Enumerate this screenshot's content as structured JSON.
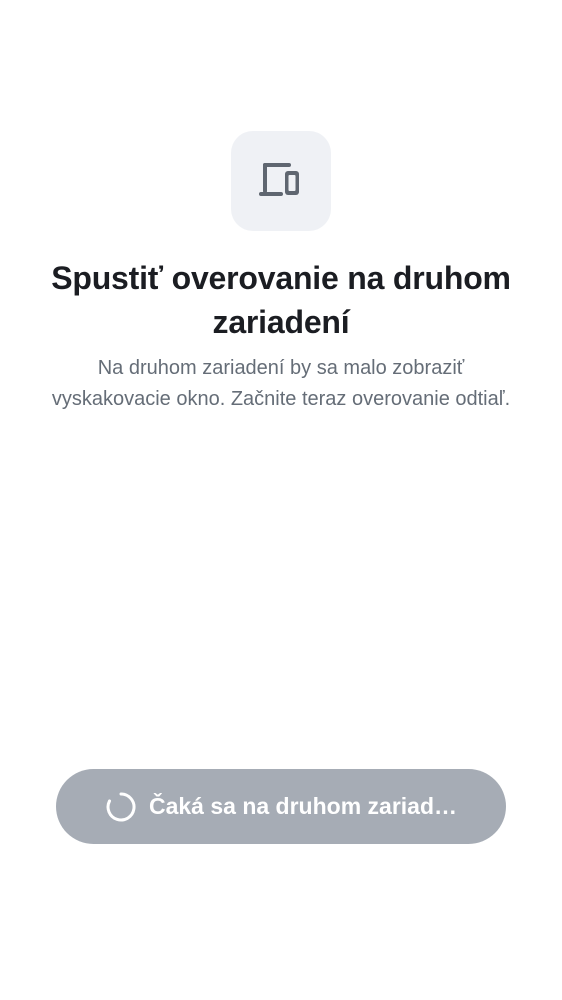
{
  "icon": {
    "name": "devices-icon",
    "color": "#5f6670",
    "tile_color": "#eff1f5"
  },
  "title": "Spustiť overovanie na druhom zariadení",
  "description": "Na druhom zariadení by sa malo zobraziť vyskakovacie okno. Začnite teraz overovanie odtiaľ.",
  "wait_button": {
    "label": "Čaká sa na druhom zariad…",
    "icon": "loading-spinner-icon",
    "background": "#a6acb5",
    "state": "disabled"
  }
}
